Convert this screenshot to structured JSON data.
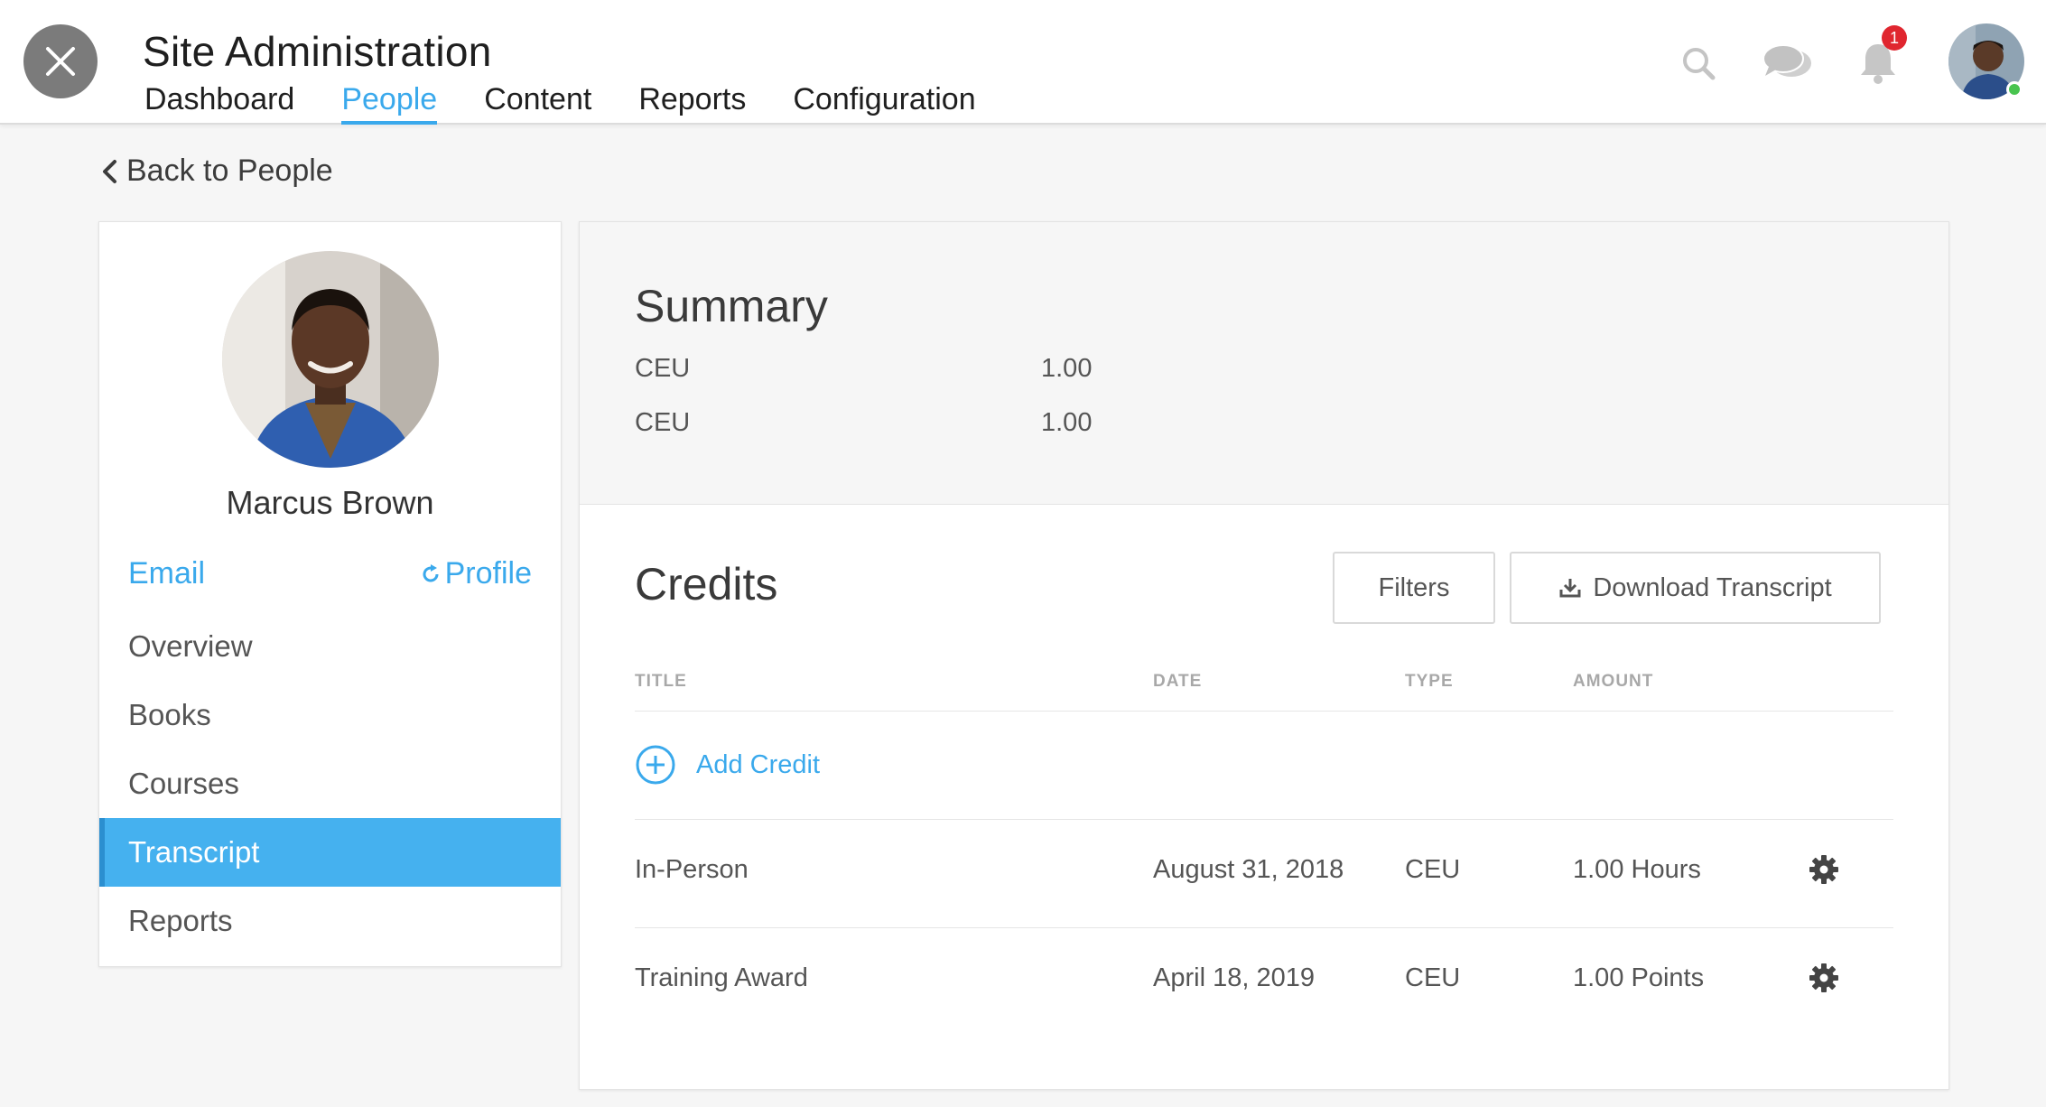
{
  "app": {
    "title": "Site Administration",
    "tabs": [
      {
        "label": "Dashboard",
        "active": false
      },
      {
        "label": "People",
        "active": true
      },
      {
        "label": "Content",
        "active": false
      },
      {
        "label": "Reports",
        "active": false
      },
      {
        "label": "Configuration",
        "active": false
      }
    ],
    "notification_count": "1",
    "icons": [
      "close-icon",
      "search-icon",
      "chat-icon",
      "bell-icon"
    ],
    "accent_color": "#3aa9ec"
  },
  "back_link": "Back to People",
  "user": {
    "name": "Marcus Brown",
    "email_label": "Email",
    "profile_label": "Profile"
  },
  "side_menu": [
    {
      "label": "Overview",
      "active": false
    },
    {
      "label": "Books",
      "active": false
    },
    {
      "label": "Courses",
      "active": false
    },
    {
      "label": "Transcript",
      "active": true
    },
    {
      "label": "Reports",
      "active": false
    }
  ],
  "summary": {
    "title": "Summary",
    "rows": [
      {
        "label": "CEU",
        "value": "1.00"
      },
      {
        "label": "CEU",
        "value": "1.00"
      }
    ]
  },
  "credits": {
    "title": "Credits",
    "filters_label": "Filters",
    "download_label": "Download Transcript",
    "columns": [
      "TITLE",
      "DATE",
      "TYPE",
      "AMOUNT"
    ],
    "add_label": "Add Credit",
    "rows": [
      {
        "title": "In-Person",
        "date": "August 31, 2018",
        "type": "CEU",
        "amount": "1.00 Hours"
      },
      {
        "title": "Training Award",
        "date": "April 18, 2019",
        "type": "CEU",
        "amount": "1.00 Points"
      }
    ]
  }
}
